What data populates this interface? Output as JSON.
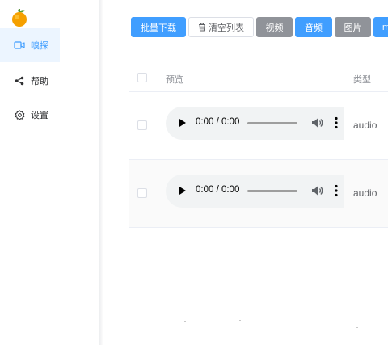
{
  "sidebar": {
    "logo": "orange-logo",
    "items": [
      {
        "label": "嗅探",
        "icon": "video-camera-icon",
        "active": true
      },
      {
        "label": "帮助",
        "icon": "share-icon",
        "active": false
      },
      {
        "label": "设置",
        "icon": "gear-icon",
        "active": false
      }
    ]
  },
  "toolbar": {
    "download_all": "批量下载",
    "clear_list": "清空列表",
    "video": "视频",
    "audio": "音频",
    "image": "图片",
    "partial_button": "m"
  },
  "table": {
    "headers": {
      "preview": "预览",
      "type": "类型"
    },
    "rows": [
      {
        "time": "0:00 / 0:00",
        "type": "audio"
      },
      {
        "time": "0:00 / 0:00",
        "type": "audio"
      }
    ]
  },
  "colors": {
    "primary": "#409eff",
    "gray_button": "#909399",
    "active_bg": "#ecf5ff",
    "player_bg": "#f1f3f4"
  }
}
